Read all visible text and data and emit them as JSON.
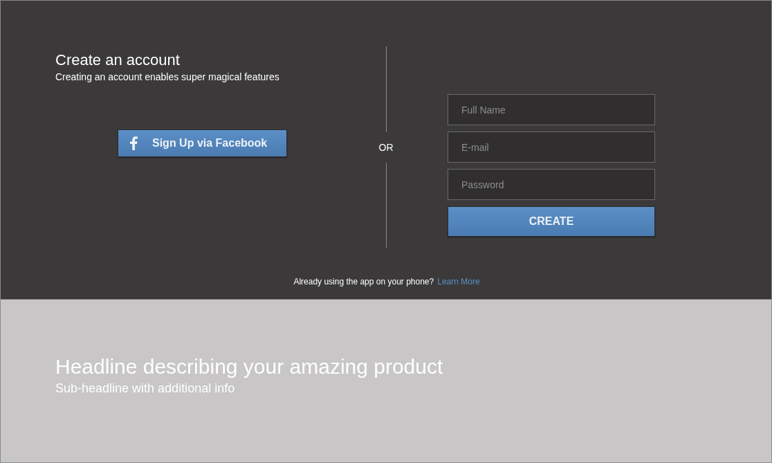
{
  "signup": {
    "title": "Create an account",
    "subtitle": "Creating an account enables super magical features",
    "facebook_button": "Sign Up via Facebook",
    "separator": "OR",
    "fields": [
      {
        "placeholder": "Full Name"
      },
      {
        "placeholder": "E-mail"
      },
      {
        "placeholder": "Password"
      }
    ],
    "create_button": "CREATE",
    "footer_text": "Already using the app on your phone?",
    "footer_link": "Learn More"
  },
  "hero": {
    "headline": "Headline describing your amazing product",
    "subheadline": "Sub-headline with additional info"
  }
}
